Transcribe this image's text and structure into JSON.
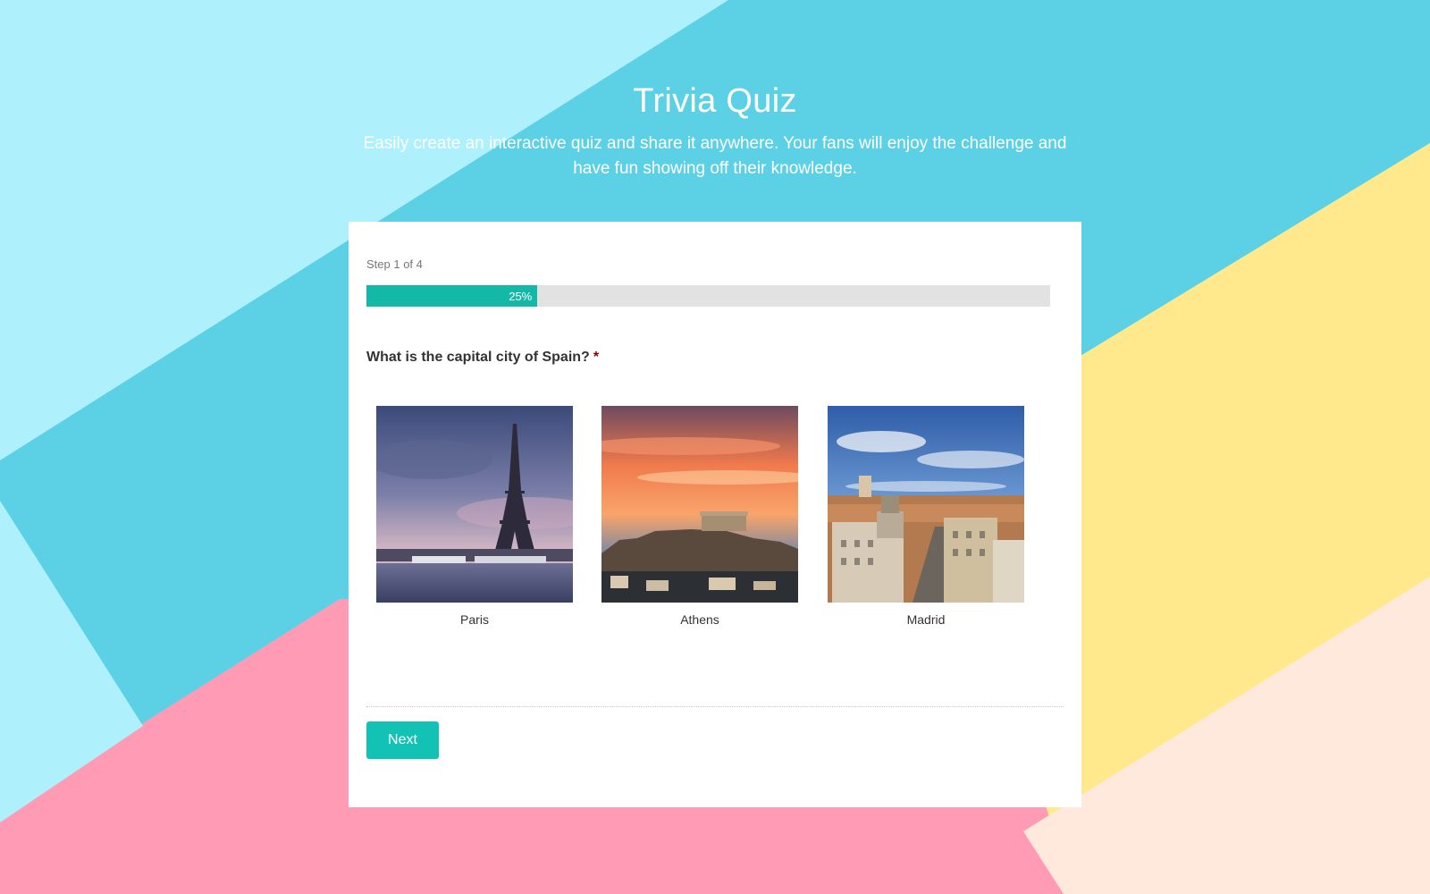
{
  "header": {
    "title": "Trivia Quiz",
    "subtitle": "Easily create an interactive quiz and share it anywhere. Your fans will enjoy the challenge and have fun showing off their knowledge."
  },
  "quiz": {
    "step_text": "Step 1 of 4",
    "progress_fraction": 0.25,
    "progress_label": "25%",
    "question": "What is the capital city of Spain?",
    "required_marker": "*",
    "options": [
      {
        "label": "Paris",
        "image": "eiffel-tower-photo"
      },
      {
        "label": "Athens",
        "image": "acropolis-sunset-photo"
      },
      {
        "label": "Madrid",
        "image": "madrid-cityscape-photo"
      }
    ],
    "next_label": "Next"
  },
  "colors": {
    "bg_light_blue": "#aef1fc",
    "bg_cyan": "#5cd1e6",
    "bg_yellow": "#ffe98c",
    "bg_pink": "#ff9bb5",
    "bg_peach": "#ffe9dc",
    "accent": "#12c2b4"
  }
}
